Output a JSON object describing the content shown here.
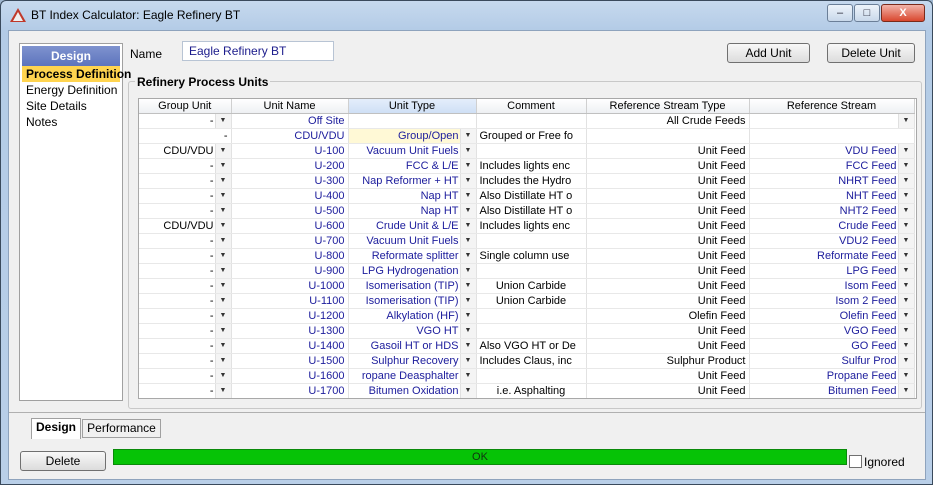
{
  "window": {
    "title": "BT Index Calculator: Eagle Refinery BT"
  },
  "nav": {
    "header": "Design",
    "items": [
      "Process Definition",
      "Energy Definition",
      "Site Details",
      "Notes"
    ]
  },
  "name_label": "Name",
  "name_value": "Eagle Refinery BT",
  "buttons": {
    "add_unit": "Add Unit",
    "delete_unit": "Delete Unit",
    "delete": "Delete"
  },
  "group_title": "Refinery Process Units",
  "columns": [
    "Group Unit",
    "Unit Name",
    "Unit Type",
    "Comment",
    "Reference Stream Type",
    "Reference Stream"
  ],
  "rows": [
    [
      "-",
      "Off Site",
      "",
      "",
      "All Crude Feeds",
      ""
    ],
    [
      "-",
      "CDU/VDU",
      "Group/Open",
      "Grouped or Free fo",
      "",
      ""
    ],
    [
      "CDU/VDU",
      "U-100",
      "Vacuum Unit Fuels",
      "",
      "Unit Feed",
      "VDU Feed"
    ],
    [
      "-",
      "U-200",
      "FCC & L/E",
      "Includes lights enc",
      "Unit Feed",
      "FCC Feed"
    ],
    [
      "-",
      "U-300",
      "Nap Reformer + HT",
      "Includes the Hydro",
      "Unit Feed",
      "NHRT Feed"
    ],
    [
      "-",
      "U-400",
      "Nap HT",
      "Also Distillate HT o",
      "Unit Feed",
      "NHT Feed"
    ],
    [
      "-",
      "U-500",
      "Nap HT",
      "Also Distillate HT o",
      "Unit Feed",
      "NHT2 Feed"
    ],
    [
      "CDU/VDU",
      "U-600",
      "Crude Unit & L/E",
      "Includes lights enc",
      "Unit Feed",
      "Crude Feed"
    ],
    [
      "-",
      "U-700",
      "Vacuum Unit Fuels",
      "",
      "Unit Feed",
      "VDU2 Feed"
    ],
    [
      "-",
      "U-800",
      "Reformate splitter",
      "Single column use",
      "Unit Feed",
      "Reformate Feed"
    ],
    [
      "-",
      "U-900",
      "LPG Hydrogenation",
      "",
      "Unit Feed",
      "LPG Feed"
    ],
    [
      "-",
      "U-1000",
      "Isomerisation (TIP)",
      "Union Carbide",
      "Unit Feed",
      "Isom Feed"
    ],
    [
      "-",
      "U-1100",
      "Isomerisation (TIP)",
      "Union Carbide",
      "Unit Feed",
      "Isom 2 Feed"
    ],
    [
      "-",
      "U-1200",
      "Alkylation (HF)",
      "",
      "Olefin Feed",
      "Olefin Feed"
    ],
    [
      "-",
      "U-1300",
      "VGO HT",
      "",
      "Unit Feed",
      "VGO Feed"
    ],
    [
      "-",
      "U-1400",
      "Gasoil HT or HDS",
      "Also VGO HT or De",
      "Unit Feed",
      "GO Feed"
    ],
    [
      "-",
      "U-1500",
      "Sulphur Recovery",
      "Includes Claus, inc",
      "Sulphur Product",
      "Sulfur Prod"
    ],
    [
      "-",
      "U-1600",
      "ropane Deasphalter",
      "",
      "Unit Feed",
      "Propane Feed"
    ],
    [
      "-",
      "U-1700",
      "Bitumen Oxidation",
      "i.e. Asphalting",
      "Unit Feed",
      "Bitumen Feed"
    ]
  ],
  "tabs": [
    "Design",
    "Performance"
  ],
  "status": "OK",
  "ignored_label": "Ignored",
  "window_buttons": {
    "minimize": "–",
    "maximize": "□",
    "close": "X"
  }
}
